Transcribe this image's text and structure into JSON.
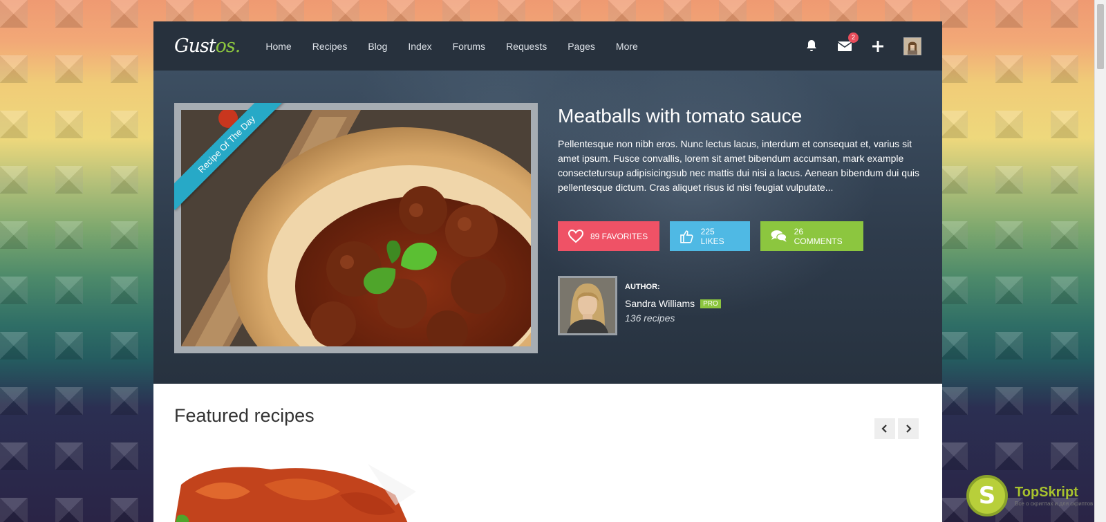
{
  "nav": {
    "logo_main": "Gust",
    "logo_accent": "os.",
    "items": [
      "Home",
      "Recipes",
      "Blog",
      "Index",
      "Forums",
      "Requests",
      "Pages",
      "More"
    ],
    "messages_badge": "2",
    "icons": [
      "bell-icon",
      "envelope-icon",
      "plus-icon",
      "user-avatar"
    ]
  },
  "hero": {
    "ribbon": "Recipe Of The Day",
    "title": "Meatballs with tomato sauce",
    "description": "Pellentesque non nibh eros. Nunc lectus lacus, interdum et consequat et, varius sit amet ipsum. Fusce convallis, lorem sit amet bibendum accumsan, mark example consectetursup adipisicingsub nec mattis dui nisi a lacus. Aenean bibendum dui quis pellentesque dictum. Cras aliquet risus id nisi feugiat vulputate...",
    "favorites": "89 FAVORITES",
    "likes": "225 LIKES",
    "comments": "26 COMMENTS"
  },
  "author": {
    "label": "AUTHOR:",
    "name": "Sandra Williams",
    "badge": "PRO",
    "count": "136 recipes"
  },
  "featured": {
    "title": "Featured recipes"
  },
  "watermark": {
    "letter": "S",
    "title": "TopSkript",
    "subtitle": "Все о скриптах и для скриптов"
  },
  "colors": {
    "nav_bg": "#27313d",
    "favorites": "#ef5266",
    "likes": "#4fb9e4",
    "comments": "#8cc63f",
    "ribbon": "#27a9c7",
    "accent": "#8cc63f"
  }
}
